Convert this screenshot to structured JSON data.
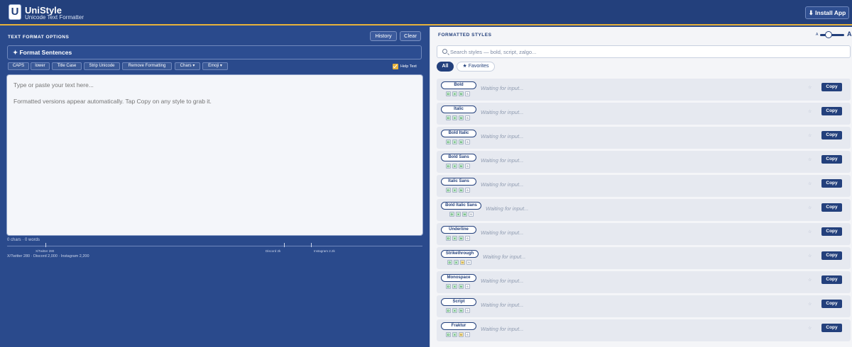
{
  "header": {
    "logo_letter": "U",
    "title": "UniStyle",
    "subtitle": "Unicode Text Formatter",
    "install_label": "⬇ Install App"
  },
  "left": {
    "section_label": "TEXT FORMAT OPTIONS",
    "history_label": "History",
    "clear_label": "Clear",
    "format_sentences_label": "✦ Format Sentences",
    "tools": [
      "CAPS",
      "lower",
      "Title Case",
      "Strip Unicode",
      "Remove Formatting",
      "Chars ▾",
      "Emoji ▾"
    ],
    "help_text_label": "Help Text",
    "help_text_checked": true,
    "textarea_placeholder": "Type or paste your text here...\n\nFormatted versions appear automatically. Tap Copy on any style to grab it.",
    "counts": "0 chars · 0 words",
    "limit_ticks": [
      "X/Twitter 280",
      "Discord 2k",
      "Instagram 2.2k"
    ],
    "limit_text": "X/Twitter 280 · Discord 2,000 · Instagram 2,200"
  },
  "right": {
    "section_label": "FORMATTED STYLES",
    "size_small_label": "A",
    "size_large_label": "A",
    "search_placeholder": "Search styles — bold, script, zalgo...",
    "tab_all": "All",
    "tab_favorites": "★ Favorites",
    "badge_letters": [
      "D",
      "X",
      "N",
      "S"
    ],
    "star_glyph": "☆",
    "copy_label": "Copy",
    "styles": [
      {
        "name": "Bold",
        "preview": "Waiting for input..."
      },
      {
        "name": "Italic",
        "preview": "Waiting for input..."
      },
      {
        "name": "Bold Italic",
        "preview": "Waiting for input..."
      },
      {
        "name": "Bold Sans",
        "preview": "Waiting for input..."
      },
      {
        "name": "Italic Sans",
        "preview": "Waiting for input..."
      },
      {
        "name": "Bold Italic Sans",
        "preview": "Waiting for input..."
      },
      {
        "name": "Underline",
        "preview": "Waiting for input..."
      },
      {
        "name": "Strikethrough",
        "preview": "Waiting for input..."
      },
      {
        "name": "Monospace",
        "preview": "Waiting for input..."
      },
      {
        "name": "Script",
        "preview": "Waiting for input..."
      },
      {
        "name": "Fraktur",
        "preview": "Waiting for input..."
      }
    ]
  },
  "colors": {
    "brand_navy": "#23407c",
    "panel_blue": "#2a4a8c",
    "accent_gold": "#e7b23a"
  }
}
